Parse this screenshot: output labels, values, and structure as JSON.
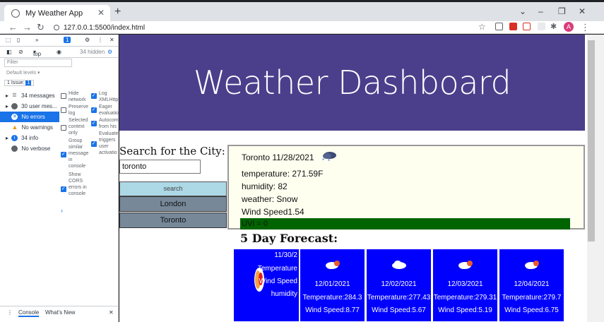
{
  "browser": {
    "tab_title": "My Weather App",
    "url": "127.0.0.1:5500/index.html",
    "avatar_letter": "A"
  },
  "devtools": {
    "issue_badge": "1",
    "context": "top",
    "hidden_count": "34 hidden",
    "filter_placeholder": "Filter",
    "levels": "Default levels",
    "issues": "1 Issue:",
    "issues_count": "1",
    "sidebar": [
      {
        "label": "34 messages"
      },
      {
        "label": "30 user mes..."
      },
      {
        "label": "No errors"
      },
      {
        "label": "No warnings"
      },
      {
        "label": "34 info"
      },
      {
        "label": "No verbose"
      }
    ],
    "options_left": [
      {
        "label": "Hide network",
        "checked": false
      },
      {
        "label": "Preserve log",
        "checked": false
      },
      {
        "label": "Selected context only",
        "checked": false
      },
      {
        "label": "Group similar message in console",
        "checked": true
      },
      {
        "label": "Show CORS errors in console",
        "checked": true
      }
    ],
    "options_right": [
      {
        "label": "Log XMLHttp",
        "checked": true
      },
      {
        "label": "Eager evaluatio",
        "checked": true
      },
      {
        "label": "Autocom from his",
        "checked": true
      },
      {
        "label": "Evaluate triggers user activatio",
        "checked": true
      }
    ],
    "drawer_tabs": [
      "Console",
      "What's New"
    ]
  },
  "page": {
    "title": "Weather Dashboard",
    "search_label": "Search for the City:",
    "search_value": "toronto",
    "search_button": "search",
    "history": [
      "London",
      "Toronto"
    ],
    "current": {
      "header": "Toronto 11/28/2021",
      "temperature": "temperature: 271.59F",
      "humidity": "humidity: 82",
      "weather": "weather: Snow",
      "wind": "Wind Speed1.54",
      "uv": "UVI = 0"
    },
    "forecast_title": "5 Day Forecast:",
    "forecast": [
      {
        "date": "11/30/2",
        "temp": "Temperature",
        "wind": "Wind Speed",
        "humidity": "humidity"
      },
      {
        "date": "12/01/2021",
        "temp": "Temperature:284.3",
        "wind": "Wind Speed:8.77"
      },
      {
        "date": "12/02/2021",
        "temp": "Temperature:277.43",
        "wind": "Wind Speed:5.67"
      },
      {
        "date": "12/03/2021",
        "temp": "Temperature:279.31",
        "wind": "Wind Speed:5.19"
      },
      {
        "date": "12/04/2021",
        "temp": "Temperature:279.7",
        "wind": "Wind Speed:6.75"
      }
    ]
  },
  "colors": {
    "header_bg": "#4b3f8c",
    "card_bg": "#0000ff",
    "uv_bar": "#006400",
    "search_btn": "#add8e6",
    "history_btn": "#778899"
  }
}
